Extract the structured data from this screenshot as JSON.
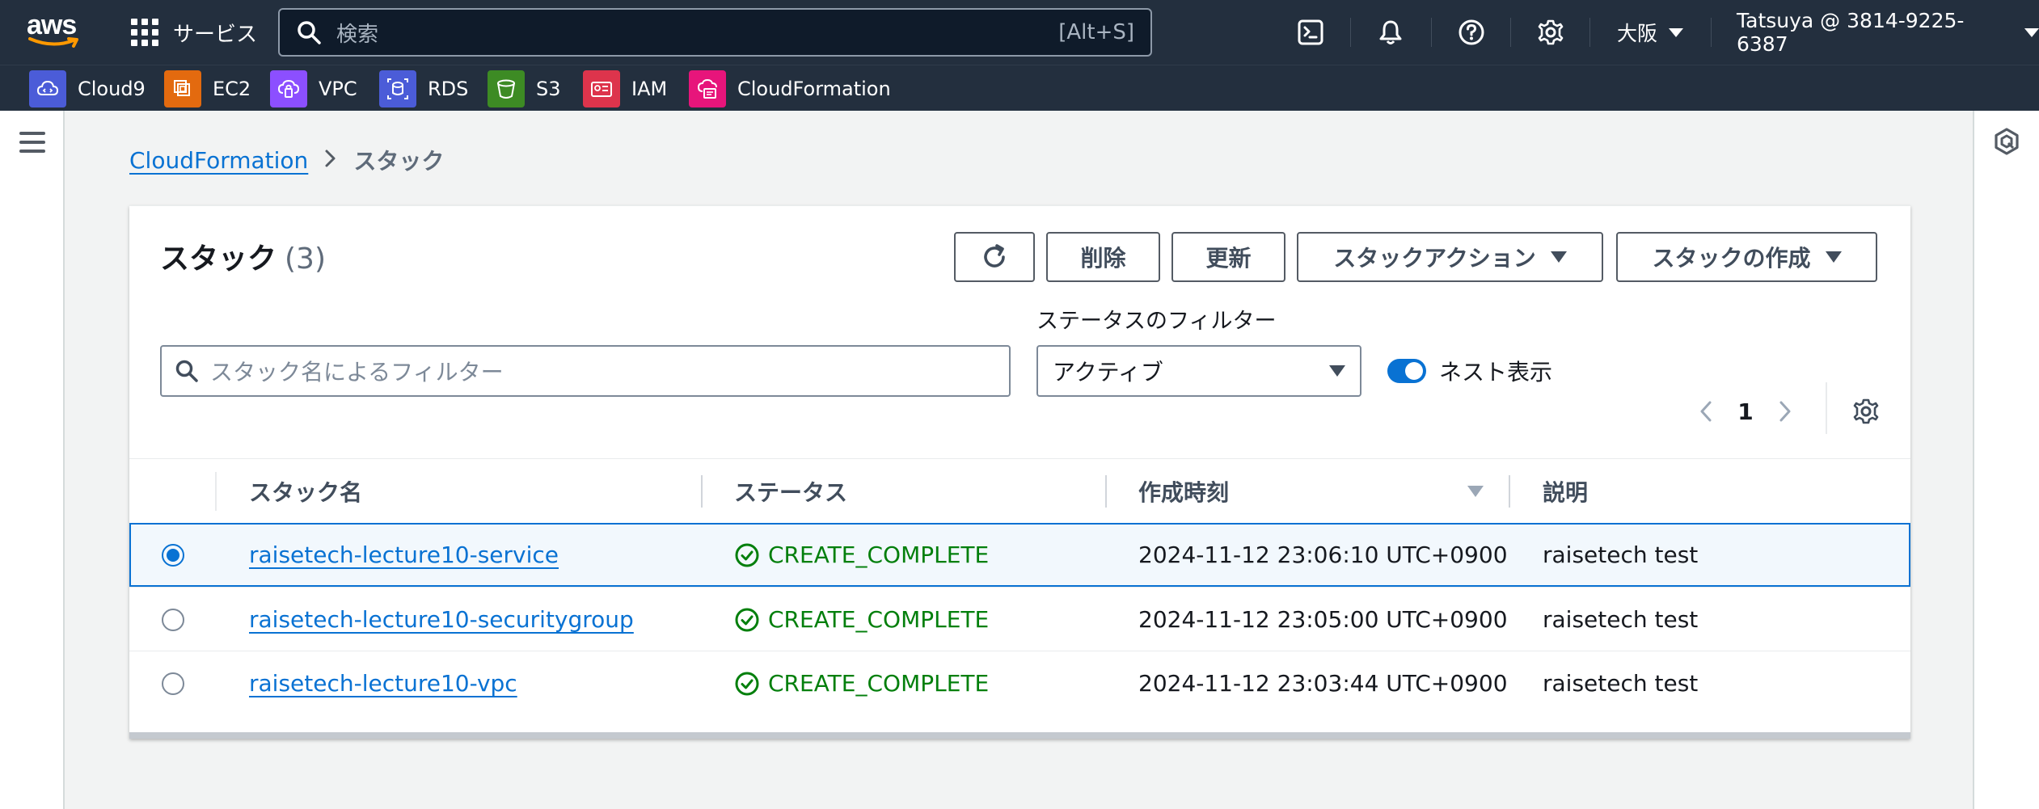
{
  "topnav": {
    "logo_text": "aws",
    "services_label": "サービス",
    "search_placeholder": "検索",
    "search_shortcut": "[Alt+S]",
    "region": "大阪",
    "account": "Tatsuya @ 3814-9225-6387"
  },
  "favorites": [
    {
      "label": "Cloud9",
      "color": "#4b5cd8",
      "icon": "cloud9-icon"
    },
    {
      "label": "EC2",
      "color": "#e36a0f",
      "icon": "ec2-icon"
    },
    {
      "label": "VPC",
      "color": "#8c4fff",
      "icon": "vpc-icon"
    },
    {
      "label": "RDS",
      "color": "#4b5cd8",
      "icon": "rds-icon"
    },
    {
      "label": "S3",
      "color": "#3d8b24",
      "icon": "s3-icon"
    },
    {
      "label": "IAM",
      "color": "#dd344c",
      "icon": "iam-icon"
    },
    {
      "label": "CloudFormation",
      "color": "#e7157b",
      "icon": "cloudformation-icon"
    }
  ],
  "breadcrumb": {
    "root": "CloudFormation",
    "current": "スタック"
  },
  "panel": {
    "title": "スタック",
    "count": "(3)",
    "buttons": {
      "delete": "削除",
      "update": "更新",
      "stack_actions": "スタックアクション",
      "create_stack": "スタックの作成"
    },
    "filter_placeholder": "スタック名によるフィルター",
    "status_filter_label": "ステータスのフィルター",
    "status_filter_value": "アクティブ",
    "nested_toggle_label": "ネスト表示",
    "page": "1"
  },
  "table": {
    "columns": [
      "スタック名",
      "ステータス",
      "作成時刻",
      "説明"
    ],
    "rows": [
      {
        "name": "raisetech-lecture10-service",
        "status": "CREATE_COMPLETE",
        "created": "2024-11-12 23:06:10 UTC+0900",
        "description": "raisetech test",
        "selected": true
      },
      {
        "name": "raisetech-lecture10-securitygroup",
        "status": "CREATE_COMPLETE",
        "created": "2024-11-12 23:05:00 UTC+0900",
        "description": "raisetech test",
        "selected": false
      },
      {
        "name": "raisetech-lecture10-vpc",
        "status": "CREATE_COMPLETE",
        "created": "2024-11-12 23:03:44 UTC+0900",
        "description": "raisetech test",
        "selected": false
      }
    ]
  },
  "colors": {
    "nav_bg": "#232f3e",
    "link": "#0972d3",
    "success": "#037f0c",
    "smile": "#ff9900"
  }
}
